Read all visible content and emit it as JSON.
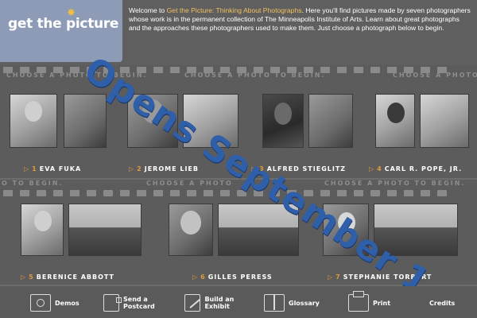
{
  "header": {
    "logo_text": "get the picture",
    "intro_lead": "Welcome to ",
    "intro_highlight": "Get the Picture: Thinking About Photographs",
    "intro_rest": ". Here you'll find pictures made by seven photographers whose work is in the permanent collection of The Minneapolis Institute of Arts. Learn about great photographs and the approaches these photographers used to make them. Just choose a photograph below to begin."
  },
  "strip1": {
    "choose_labels": [
      "CHOOSE A PHOTO TO BEGIN.",
      "CHOOSE A PHOTO TO BEGIN.",
      "CHOOSE A PHOTO"
    ],
    "photographers": [
      {
        "num": "1",
        "name": "EVA FUKA"
      },
      {
        "num": "2",
        "name": "JEROME LIEB"
      },
      {
        "num": "3",
        "name": "ALFRED STIEGLITZ"
      },
      {
        "num": "4",
        "name": "CARL R. POPE, JR."
      }
    ]
  },
  "strip2": {
    "choose_labels": [
      "O TO BEGIN.",
      "CHOOSE A PHOTO",
      "CHOOSE A PHOTO TO BEGIN."
    ],
    "photographers": [
      {
        "num": "5",
        "name": "BERENICE ABBOTT"
      },
      {
        "num": "6",
        "name": "GILLES PERESS"
      },
      {
        "num": "7",
        "name": "STEPHANIE TORBERT"
      }
    ]
  },
  "overlay_text": "Opens September 1",
  "nav": {
    "items": [
      {
        "label": "Demos",
        "icon": "camera-icon"
      },
      {
        "label": "Send a Postcard",
        "icon": "postcard-icon"
      },
      {
        "label": "Build an Exhibit",
        "icon": "easel-icon"
      },
      {
        "label": "Glossary",
        "icon": "book-icon"
      },
      {
        "label": "Print",
        "icon": "printer-icon"
      },
      {
        "label": "Credits",
        "icon": ""
      }
    ]
  },
  "colors": {
    "accent": "#e09a3a",
    "overlay": "#2f5fa8",
    "logo_bg": "#8e9bb7"
  }
}
